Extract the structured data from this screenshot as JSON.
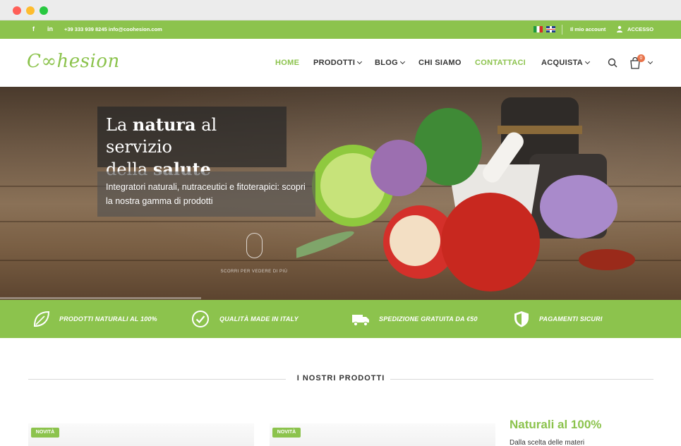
{
  "topbar": {
    "contact": "+39 333 939 8245 info@coohesion.com",
    "social": [
      "f",
      "in"
    ],
    "languages": [
      "it-flag",
      "en-flag"
    ],
    "my_account": "Il mio account",
    "login": "ACCESSO"
  },
  "header": {
    "logo": "C∞hesion",
    "nav": [
      "HOME",
      "PRODOTTI",
      "BLOG",
      "CHI SIAMO",
      "CONTATTACI",
      "ACQUISTA"
    ],
    "cart_count": "0"
  },
  "hero": {
    "title_line1_pre": "La ",
    "title_line1_bold": "natura",
    "title_line1_post": " al servizio",
    "title_line2_pre": "della ",
    "title_line2_bold": "salute",
    "subtitle": "Integratori naturali, nutraceutici e fitoterapici: scopri la nostra gamma di prodotti",
    "scroll_hint": "SCORRI PER VEDERE DI PIÙ"
  },
  "features": [
    {
      "icon": "leaf-icon",
      "label": "PRODOTTI NATURALI AL 100%"
    },
    {
      "icon": "check-circle-icon",
      "label": "QUALITÀ MADE IN ITALY"
    },
    {
      "icon": "truck-icon",
      "label": "SPEDIZIONE GRATUITA DA €50"
    },
    {
      "icon": "shield-icon",
      "label": "PAGAMENTI SICURI"
    }
  ],
  "products_section": {
    "title": "I NOSTRI PRODOTTI",
    "badge": "NOVITÀ",
    "side_title": "Naturali al 100%",
    "side_text": "Dalla scelta delle materi"
  },
  "colors": {
    "accent": "#8cc34d",
    "badge": "#e8734a"
  }
}
